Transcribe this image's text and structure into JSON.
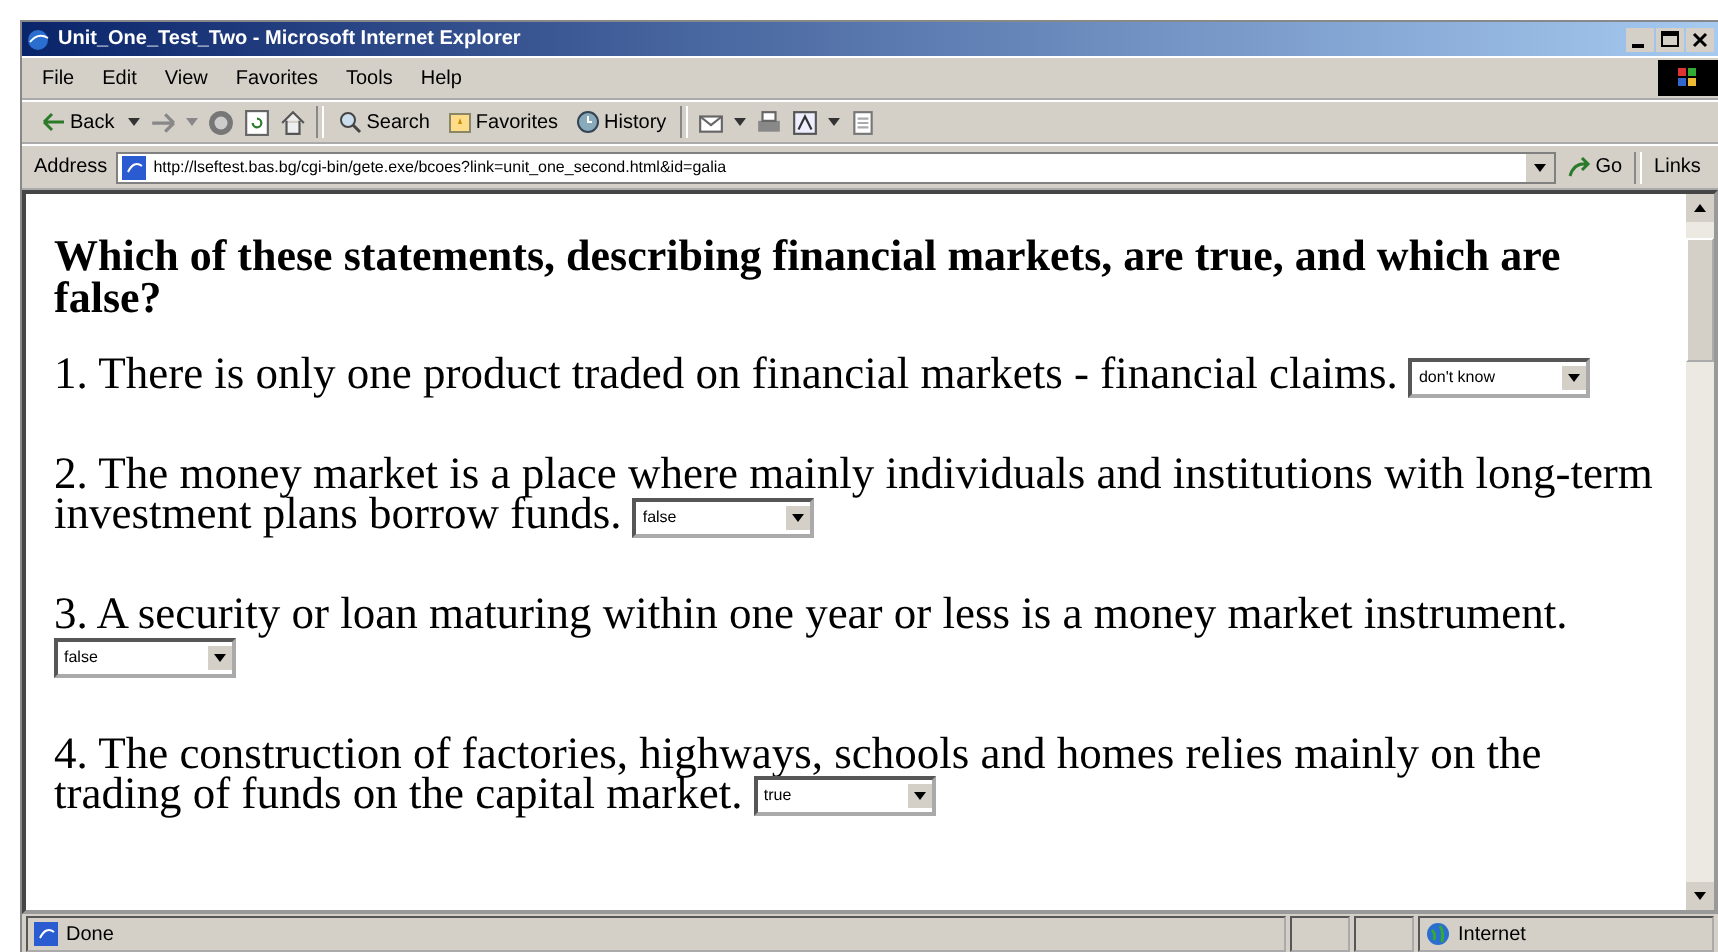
{
  "window": {
    "title": "Unit_One_Test_Two - Microsoft Internet Explorer"
  },
  "menu": [
    "File",
    "Edit",
    "View",
    "Favorites",
    "Tools",
    "Help"
  ],
  "toolbar": {
    "back": "Back",
    "search": "Search",
    "favorites": "Favorites",
    "history": "History"
  },
  "address": {
    "label": "Address",
    "url": "http://lseftest.bas.bg/cgi-bin/gete.exe/bcoes?link=unit_one_second.html&id=galia",
    "go": "Go",
    "links": "Links"
  },
  "page": {
    "heading": "Which of these statements, describing financial markets, are true, and which are false?",
    "questions": [
      {
        "text": "1. There is only one product traded on financial markets - financial claims.",
        "answer": "don't know"
      },
      {
        "text": "2. The money market is a place where mainly individuals and institutions with long-term investment plans borrow funds.",
        "answer": "false"
      },
      {
        "text": "3. A security or loan maturing within one year or less is a money market instrument.",
        "answer": "false"
      },
      {
        "text": "4. The construction of factories, highways, schools and homes relies mainly on the trading of funds on the capital market.",
        "answer": "true"
      }
    ]
  },
  "status_bar": {
    "text": "Done",
    "zone": "Internet"
  }
}
